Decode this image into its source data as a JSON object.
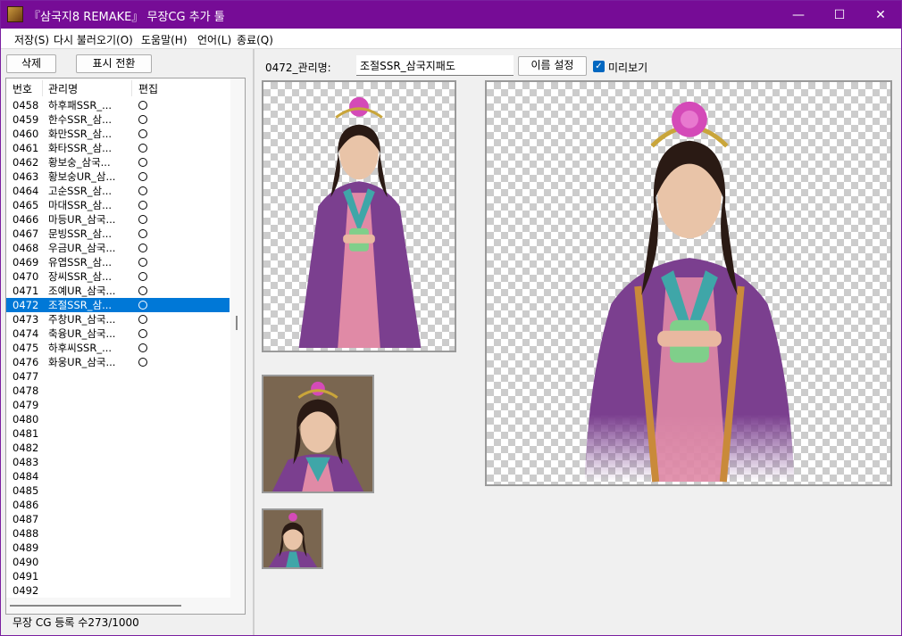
{
  "window": {
    "title": "『삼국지8 REMAKE』 무장CG 추가 툴",
    "icon": "app-portrait-icon",
    "minimize_glyph": "—",
    "maximize_glyph": "☐",
    "close_glyph": "✕"
  },
  "menu": [
    {
      "label": "저장(S)"
    },
    {
      "label": "다시 불러오기(O)"
    },
    {
      "label": "도움말(H)"
    },
    {
      "label": "언어(L)"
    },
    {
      "label": "종료(Q)"
    }
  ],
  "left_panel": {
    "delete_button": "삭제",
    "toggle_view_button": "표시 전환",
    "columns": [
      "번호",
      "관리명",
      "편집"
    ],
    "rows": [
      {
        "id": "0458",
        "name": "하후패SSR_...",
        "edit": true
      },
      {
        "id": "0459",
        "name": "한수SSR_삼...",
        "edit": true
      },
      {
        "id": "0460",
        "name": "화만SSR_삼...",
        "edit": true
      },
      {
        "id": "0461",
        "name": "화타SSR_삼...",
        "edit": true
      },
      {
        "id": "0462",
        "name": "황보숭_삼국...",
        "edit": true
      },
      {
        "id": "0463",
        "name": "황보숭UR_삼...",
        "edit": true
      },
      {
        "id": "0464",
        "name": "고순SSR_삼...",
        "edit": true
      },
      {
        "id": "0465",
        "name": "마대SSR_삼...",
        "edit": true
      },
      {
        "id": "0466",
        "name": "마등UR_삼국...",
        "edit": true
      },
      {
        "id": "0467",
        "name": "문빙SSR_삼...",
        "edit": true
      },
      {
        "id": "0468",
        "name": "우금UR_삼국...",
        "edit": true
      },
      {
        "id": "0469",
        "name": "유엽SSR_삼...",
        "edit": true
      },
      {
        "id": "0470",
        "name": "장씨SSR_삼...",
        "edit": true
      },
      {
        "id": "0471",
        "name": "조예UR_삼국...",
        "edit": true
      },
      {
        "id": "0472",
        "name": "조절SSR_삼...",
        "edit": true,
        "selected": true
      },
      {
        "id": "0473",
        "name": "주창UR_삼국...",
        "edit": true
      },
      {
        "id": "0474",
        "name": "축융UR_삼국...",
        "edit": true
      },
      {
        "id": "0475",
        "name": "하후씨SSR_...",
        "edit": true
      },
      {
        "id": "0476",
        "name": "화웅UR_삼국...",
        "edit": true
      },
      {
        "id": "0477",
        "name": "",
        "edit": false
      },
      {
        "id": "0478",
        "name": "",
        "edit": false
      },
      {
        "id": "0479",
        "name": "",
        "edit": false
      },
      {
        "id": "0480",
        "name": "",
        "edit": false
      },
      {
        "id": "0481",
        "name": "",
        "edit": false
      },
      {
        "id": "0482",
        "name": "",
        "edit": false
      },
      {
        "id": "0483",
        "name": "",
        "edit": false
      },
      {
        "id": "0484",
        "name": "",
        "edit": false
      },
      {
        "id": "0485",
        "name": "",
        "edit": false
      },
      {
        "id": "0486",
        "name": "",
        "edit": false
      },
      {
        "id": "0487",
        "name": "",
        "edit": false
      },
      {
        "id": "0488",
        "name": "",
        "edit": false
      },
      {
        "id": "0489",
        "name": "",
        "edit": false
      },
      {
        "id": "0490",
        "name": "",
        "edit": false
      },
      {
        "id": "0491",
        "name": "",
        "edit": false
      },
      {
        "id": "0492",
        "name": "",
        "edit": false
      }
    ],
    "status": "무장 CG 등록 수273/1000"
  },
  "right_panel": {
    "name_label": "0472_관리명:",
    "name_value": "조절SSR_삼국지패도",
    "set_name_button": "이름 설정",
    "preview_checked": true,
    "preview_label": "미리보기",
    "checkmark": "✓"
  },
  "colors": {
    "titlebar": "#760c96",
    "selection": "#0078d7",
    "robe_purple": "#7b3f8f",
    "robe_teal": "#3fa6a8",
    "robe_pink": "#e08aa6",
    "jade": "#7fcf8a",
    "crown_flower": "#d44ab8"
  }
}
